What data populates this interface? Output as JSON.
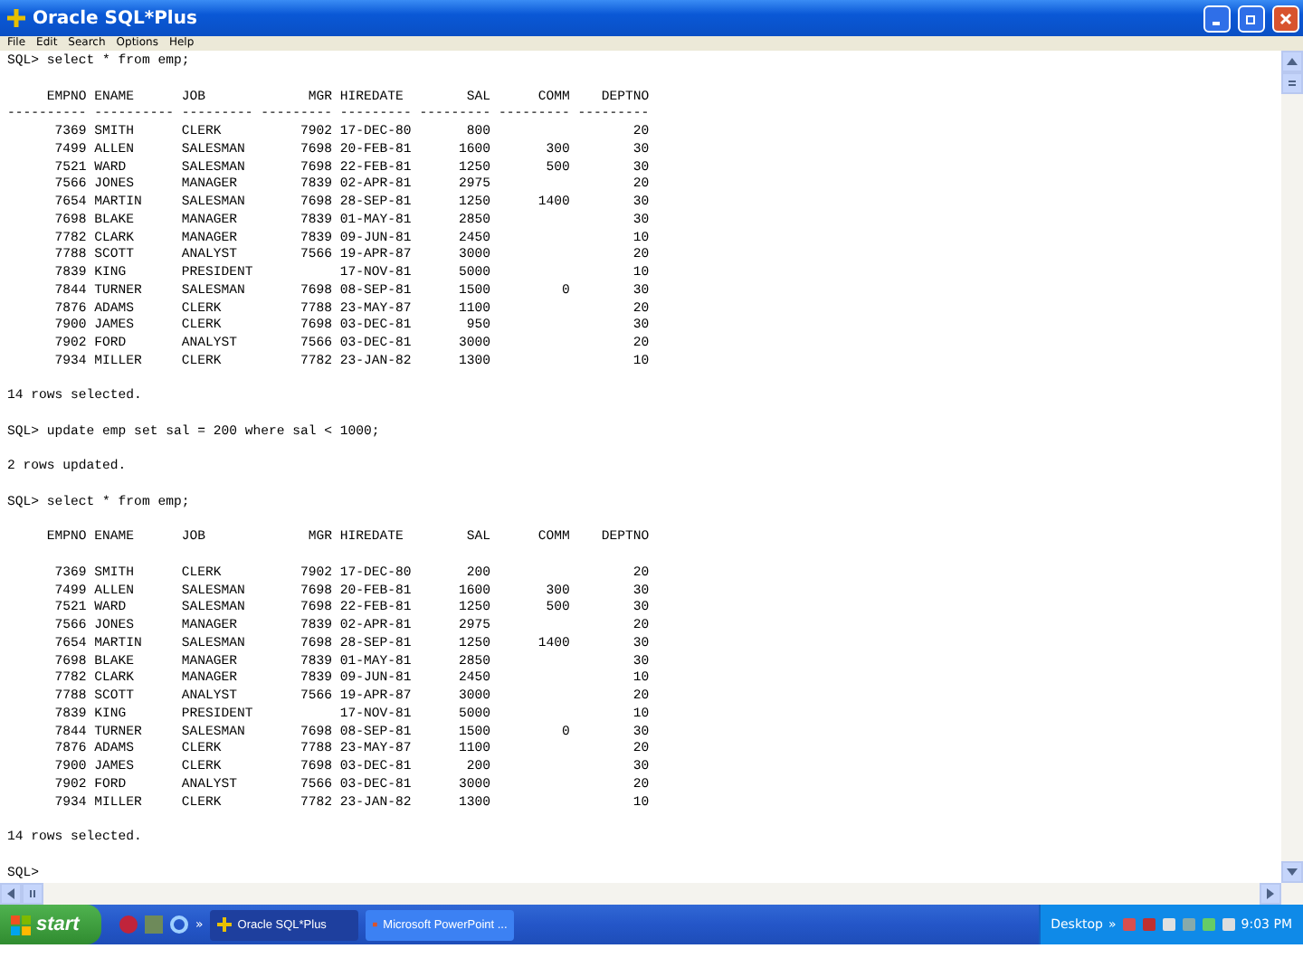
{
  "window": {
    "title": "Oracle SQL*Plus"
  },
  "menu": [
    "File",
    "Edit",
    "Search",
    "Options",
    "Help"
  ],
  "console": [
    {
      "kind": "line",
      "text": "SQL> select * from emp;"
    },
    {
      "kind": "table",
      "columns": [
        "EMPNO",
        "ENAME",
        "JOB",
        "MGR",
        "HIREDATE",
        "SAL",
        "COMM",
        "DEPTNO"
      ],
      "separator": "---------- ---------- --------- --------- --------- --------- --------- ---------",
      "rows": [
        [
          "7369",
          "SMITH",
          "CLERK",
          "7902",
          "17-DEC-80",
          "800",
          "",
          "20"
        ],
        [
          "7499",
          "ALLEN",
          "SALESMAN",
          "7698",
          "20-FEB-81",
          "1600",
          "300",
          "30"
        ],
        [
          "7521",
          "WARD",
          "SALESMAN",
          "7698",
          "22-FEB-81",
          "1250",
          "500",
          "30"
        ],
        [
          "7566",
          "JONES",
          "MANAGER",
          "7839",
          "02-APR-81",
          "2975",
          "",
          "20"
        ],
        [
          "7654",
          "MARTIN",
          "SALESMAN",
          "7698",
          "28-SEP-81",
          "1250",
          "1400",
          "30"
        ],
        [
          "7698",
          "BLAKE",
          "MANAGER",
          "7839",
          "01-MAY-81",
          "2850",
          "",
          "30"
        ],
        [
          "7782",
          "CLARK",
          "MANAGER",
          "7839",
          "09-JUN-81",
          "2450",
          "",
          "10"
        ],
        [
          "7788",
          "SCOTT",
          "ANALYST",
          "7566",
          "19-APR-87",
          "3000",
          "",
          "20"
        ],
        [
          "7839",
          "KING",
          "PRESIDENT",
          "",
          "17-NOV-81",
          "5000",
          "",
          "10"
        ],
        [
          "7844",
          "TURNER",
          "SALESMAN",
          "7698",
          "08-SEP-81",
          "1500",
          "0",
          "30"
        ],
        [
          "7876",
          "ADAMS",
          "CLERK",
          "7788",
          "23-MAY-87",
          "1100",
          "",
          "20"
        ],
        [
          "7900",
          "JAMES",
          "CLERK",
          "7698",
          "03-DEC-81",
          "950",
          "",
          "30"
        ],
        [
          "7902",
          "FORD",
          "ANALYST",
          "7566",
          "03-DEC-81",
          "3000",
          "",
          "20"
        ],
        [
          "7934",
          "MILLER",
          "CLERK",
          "7782",
          "23-JAN-82",
          "1300",
          "",
          "10"
        ]
      ]
    },
    {
      "kind": "line",
      "text": "14 rows selected."
    },
    {
      "kind": "line",
      "text": "SQL> update emp set sal = 200 where sal < 1000;"
    },
    {
      "kind": "line",
      "text": "2 rows updated."
    },
    {
      "kind": "line",
      "text": "SQL> select * from emp;"
    },
    {
      "kind": "table",
      "columns": [
        "EMPNO",
        "ENAME",
        "JOB",
        "MGR",
        "HIREDATE",
        "SAL",
        "COMM",
        "DEPTNO"
      ],
      "rows": [
        [
          "7369",
          "SMITH",
          "CLERK",
          "7902",
          "17-DEC-80",
          "200",
          "",
          "20"
        ],
        [
          "7499",
          "ALLEN",
          "SALESMAN",
          "7698",
          "20-FEB-81",
          "1600",
          "300",
          "30"
        ],
        [
          "7521",
          "WARD",
          "SALESMAN",
          "7698",
          "22-FEB-81",
          "1250",
          "500",
          "30"
        ],
        [
          "7566",
          "JONES",
          "MANAGER",
          "7839",
          "02-APR-81",
          "2975",
          "",
          "20"
        ],
        [
          "7654",
          "MARTIN",
          "SALESMAN",
          "7698",
          "28-SEP-81",
          "1250",
          "1400",
          "30"
        ],
        [
          "7698",
          "BLAKE",
          "MANAGER",
          "7839",
          "01-MAY-81",
          "2850",
          "",
          "30"
        ],
        [
          "7782",
          "CLARK",
          "MANAGER",
          "7839",
          "09-JUN-81",
          "2450",
          "",
          "10"
        ],
        [
          "7788",
          "SCOTT",
          "ANALYST",
          "7566",
          "19-APR-87",
          "3000",
          "",
          "20"
        ],
        [
          "7839",
          "KING",
          "PRESIDENT",
          "",
          "17-NOV-81",
          "5000",
          "",
          "10"
        ],
        [
          "7844",
          "TURNER",
          "SALESMAN",
          "7698",
          "08-SEP-81",
          "1500",
          "0",
          "30"
        ],
        [
          "7876",
          "ADAMS",
          "CLERK",
          "7788",
          "23-MAY-87",
          "1100",
          "",
          "20"
        ],
        [
          "7900",
          "JAMES",
          "CLERK",
          "7698",
          "03-DEC-81",
          "200",
          "",
          "30"
        ],
        [
          "7902",
          "FORD",
          "ANALYST",
          "7566",
          "03-DEC-81",
          "3000",
          "",
          "20"
        ],
        [
          "7934",
          "MILLER",
          "CLERK",
          "7782",
          "23-JAN-82",
          "1300",
          "",
          "10"
        ]
      ]
    },
    {
      "kind": "line",
      "text": "14 rows selected."
    },
    {
      "kind": "line",
      "text": "SQL>"
    }
  ],
  "taskbar": {
    "start": "start",
    "more": "»",
    "tasks": [
      {
        "label": "Oracle SQL*Plus",
        "selected": true,
        "kind": "sqlplus"
      },
      {
        "label": "Microsoft PowerPoint ...",
        "selected": false,
        "kind": "powerpoint"
      }
    ],
    "toolbar": "Desktop",
    "toolbar_more": "»",
    "clock": "9:03 PM"
  }
}
